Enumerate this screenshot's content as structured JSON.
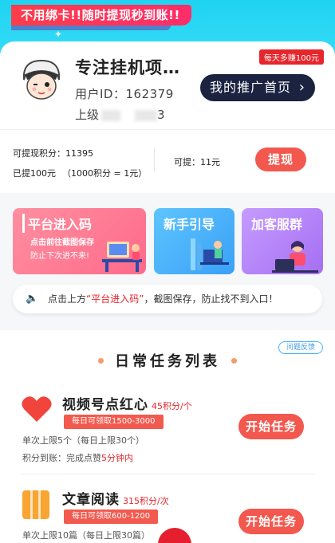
{
  "promo": {
    "banner": "不用绑卡!!随时提现秒到账!!"
  },
  "profile": {
    "bonus_tag": "每天多赚100元",
    "name": "专注挂机项…",
    "user_id_label": "用户ID：",
    "user_id": "162379",
    "superior_label": "上级",
    "superior_tail": "3",
    "promo_button": "我的推广首页",
    "chevron": "›"
  },
  "wallet": {
    "withdrawable_points_label": "可提现积分：",
    "withdrawable_points": "11395",
    "withdrawn_label": "已提100元",
    "rate": "（1000积分 = 1元）",
    "available_label": "可提：",
    "available_amount": "11元",
    "withdraw_button": "提现"
  },
  "features": [
    {
      "title": "平台进入码",
      "line1": "点击前往截图保存",
      "line2": "防止下次进不来!"
    },
    {
      "title": "新手引导"
    },
    {
      "title": "加客服群"
    }
  ],
  "notice": {
    "prefix": "点击上方",
    "highlight": "“平台进入码”",
    "suffix": "，截图保存，防止找不到入口！"
  },
  "tasks_section": {
    "feedback": "问题反馈",
    "title": "日常任务列表"
  },
  "tasks": [
    {
      "name": "视频号点红心",
      "points": "45积分/个",
      "tag": "每日可领取1500-3000",
      "line1": "单次上限5个（每日上限30个）",
      "line2_prefix": "积分到账：完成点赞",
      "line2_highlight": "5分钟内",
      "button": "开始任务"
    },
    {
      "name": "文章阅读",
      "points": "315积分/次",
      "tag": "每日可领取600-1200",
      "line1": "单次上限10篇（每日上限30篇）",
      "button": "开始任务"
    }
  ],
  "colors": {
    "accent_red": "#f2584e",
    "top_cyan": "#1fd3f2",
    "dark_button": "#1b2340"
  }
}
